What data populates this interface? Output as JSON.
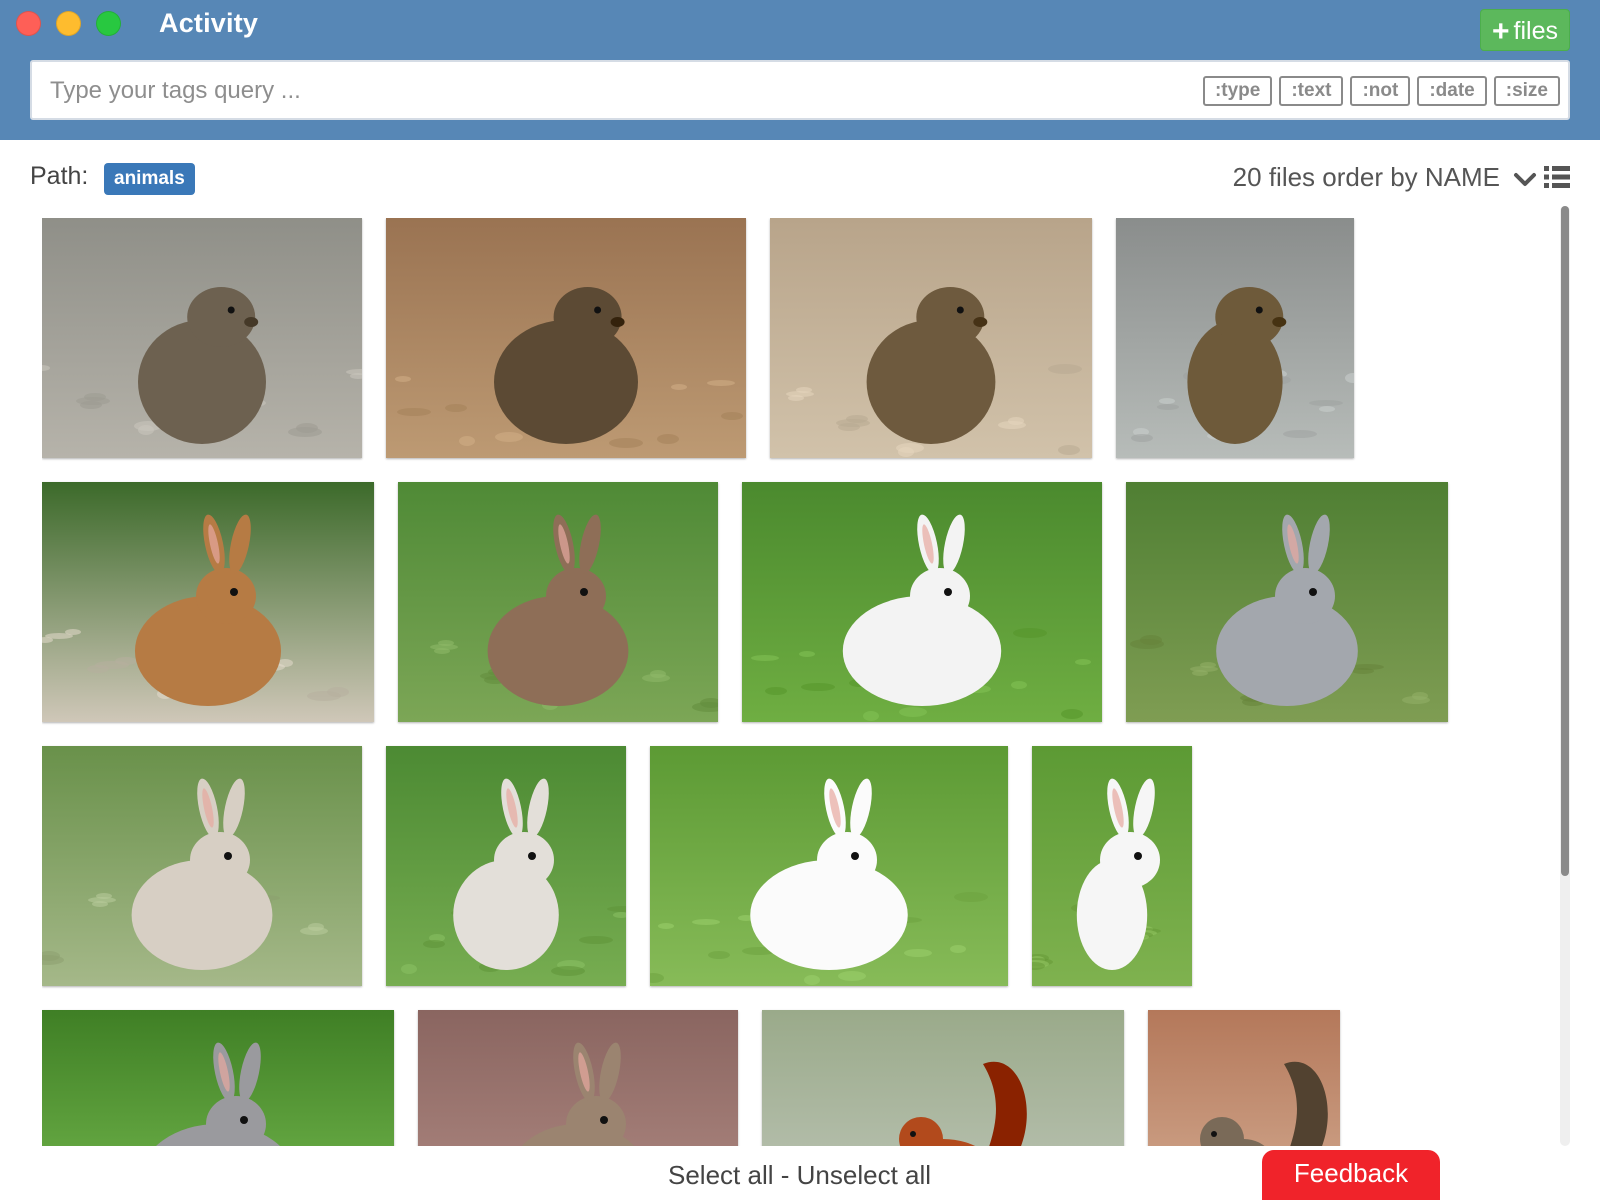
{
  "window": {
    "title": "Activity"
  },
  "header": {
    "add_files_label": "files"
  },
  "search": {
    "placeholder": "Type your tags query ...",
    "filters": [
      ":type",
      ":text",
      ":not",
      ":date",
      ":size"
    ]
  },
  "path": {
    "label": "Path:",
    "tag": "animals"
  },
  "listing": {
    "summary": "20 files order by NAME"
  },
  "footer": {
    "select_all": "Select all",
    "separator": "-",
    "unselect_all": "Unselect all",
    "feedback": "Feedback"
  },
  "colors": {
    "header": "#5787b6",
    "accent": "#3a78b8",
    "add_button": "#5cb85c",
    "feedback": "#f0232a"
  },
  "icons": {
    "add": "plus-icon",
    "order": "chevron-down-icon",
    "view": "list-view-icon"
  },
  "gallery": {
    "rows": [
      [
        {
          "subject": "marmot",
          "bg": [
            "#8f8f88",
            "#b6b3aa"
          ],
          "animal": "#6d6150"
        },
        {
          "subject": "marmot",
          "bg": [
            "#9a7352",
            "#bd9a73"
          ],
          "animal": "#5c4a34"
        },
        {
          "subject": "marmot",
          "bg": [
            "#b8a48a",
            "#d1c2aa"
          ],
          "animal": "#6e5a3e"
        },
        {
          "subject": "marmot",
          "bg": [
            "#8a8d8c",
            "#b7bcb9"
          ],
          "animal": "#6e5a3a"
        }
      ],
      [
        {
          "subject": "rabbit",
          "bg": [
            "#3c6a2a",
            "#cfc7b8"
          ],
          "animal": "#b67b44"
        },
        {
          "subject": "rabbit",
          "bg": [
            "#4f8a36",
            "#7ca656"
          ],
          "animal": "#8e6e57"
        },
        {
          "subject": "rabbit",
          "bg": [
            "#4b8a2e",
            "#6fae42"
          ],
          "animal": "#f3f3f3"
        },
        {
          "subject": "rabbit",
          "bg": [
            "#4f7f33",
            "#7f9d53"
          ],
          "animal": "#a3a7ad"
        }
      ],
      [
        {
          "subject": "rabbit",
          "bg": [
            "#69914a",
            "#a5b889"
          ],
          "animal": "#d7cfc4"
        },
        {
          "subject": "rabbit",
          "bg": [
            "#4c8a33",
            "#77ad51"
          ],
          "animal": "#e3dfd9"
        },
        {
          "subject": "rabbit",
          "bg": [
            "#5c9a34",
            "#87bb58"
          ],
          "animal": "#fbfbfb"
        },
        {
          "subject": "rabbit",
          "bg": [
            "#5c9a34",
            "#7fb24f"
          ],
          "animal": "#f6f6f6"
        }
      ],
      [
        {
          "subject": "rabbit",
          "bg": [
            "#3f7f25",
            "#7bbf53"
          ],
          "animal": "#9a9a9e"
        },
        {
          "subject": "rabbit",
          "bg": [
            "#8a6560",
            "#b48e87"
          ],
          "animal": "#9b8470"
        },
        {
          "subject": "squirrel",
          "bg": [
            "#9aaa8a",
            "#c3c9be"
          ],
          "animal": "#b24a1c"
        },
        {
          "subject": "squirrel",
          "bg": [
            "#b4785a",
            "#d8b39a"
          ],
          "animal": "#7a6a58"
        }
      ]
    ]
  }
}
